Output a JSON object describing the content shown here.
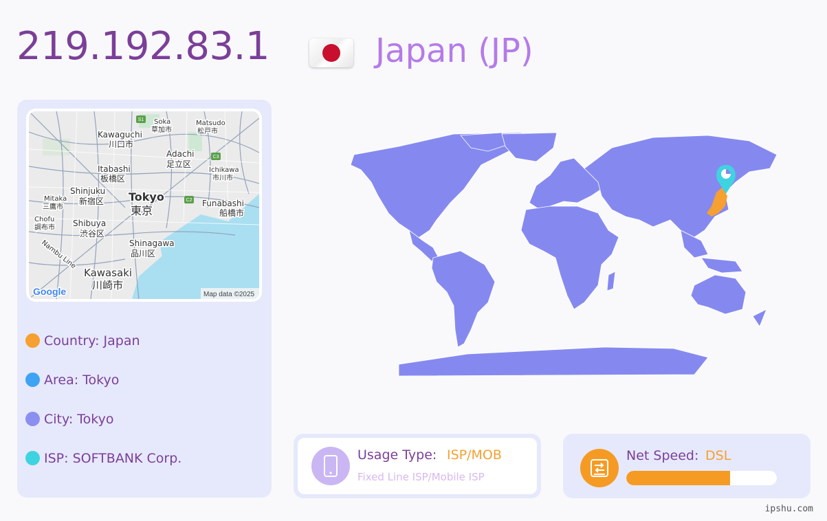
{
  "header": {
    "ip": "219.192.83.1",
    "country_title": "Japan (JP)",
    "flag": "japan-flag"
  },
  "map": {
    "labels": [
      {
        "text": "Kawaguchi",
        "sub": "川口市"
      },
      {
        "text": "Soka",
        "sub": "草加市"
      },
      {
        "text": "Matsudo",
        "sub": "松戸市"
      },
      {
        "text": "Adachi",
        "sub": "足立区"
      },
      {
        "text": "Itabashi",
        "sub": "板橋区"
      },
      {
        "text": "Ichikawa",
        "sub": "市川市"
      },
      {
        "text": "Shinjuku",
        "sub": "新宿区"
      },
      {
        "text": "Tokyo",
        "sub": "東京"
      },
      {
        "text": "Funabashi",
        "sub": "船橋市"
      },
      {
        "text": "Mitaka",
        "sub": "三鷹市"
      },
      {
        "text": "Chofu",
        "sub": "調布市"
      },
      {
        "text": "Shibuya",
        "sub": "渋谷区"
      },
      {
        "text": "Shinagawa",
        "sub": "品川区"
      },
      {
        "text": "Kawasaki",
        "sub": "川崎市"
      },
      {
        "text": "Nambu Line",
        "sub": ""
      }
    ],
    "shields": [
      "S1",
      "C3",
      "C2"
    ],
    "logo": "Google",
    "attribution": "Map data ©2025"
  },
  "info": [
    {
      "label": "Country: Japan",
      "color": "#f5a030"
    },
    {
      "label": "Area: Tokyo",
      "color": "#3fa3f4"
    },
    {
      "label": "City: Tokyo",
      "color": "#8a8ff0"
    },
    {
      "label": "ISP: SOFTBANK Corp.",
      "color": "#3ed3e0"
    }
  ],
  "world_map": {
    "land_color": "#8589ef",
    "highlight_color": "#f5a030",
    "pin_color": "#3ed3e0",
    "highlight": "Japan"
  },
  "usage": {
    "label": "Usage Type:",
    "value": "ISP/MOB",
    "description": "Fixed Line ISP/Mobile ISP",
    "icon": "mobile-phone-icon"
  },
  "speed": {
    "label": "Net Speed:",
    "value": "DSL",
    "level_percent": 69,
    "icon": "network-card-icon"
  },
  "footer": {
    "site": "ipshu.com"
  }
}
